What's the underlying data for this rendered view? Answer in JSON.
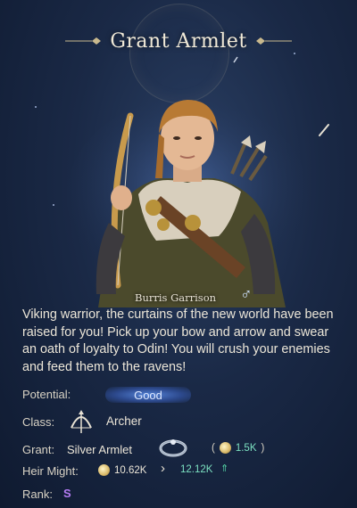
{
  "dialog": {
    "title": "Grant Armlet"
  },
  "hero": {
    "name": "Burris Garrison",
    "gender_symbol": "♂",
    "description": "Viking warrior, the curtains of the new world have been raised for you! Pick up your bow and arrow and swear an oath of loyalty to Odin! You will crush your enemies and feed them to the ravens!"
  },
  "stats": {
    "potential_label": "Potential:",
    "potential_value": "Good",
    "class_label": "Class:",
    "class_value": "Archer",
    "class_icon": "bow-icon",
    "grant_label": "Grant:",
    "grant_item": "Silver Armlet",
    "grant_item_icon": "armlet-icon",
    "grant_cost_open": "(",
    "grant_cost": "1.5K",
    "grant_cost_close": ")",
    "might_label": "Heir Might:",
    "might_current": "10.62K",
    "might_arrow": "›",
    "might_new": "12.12K",
    "might_up_symbol": "⇑",
    "rank_label": "Rank:",
    "rank_value": "S"
  },
  "colors": {
    "background": "#1a2946",
    "increase": "#7ce0c0",
    "rank_s": "#b57cf5",
    "potential_badge": "#5a8ce6"
  }
}
